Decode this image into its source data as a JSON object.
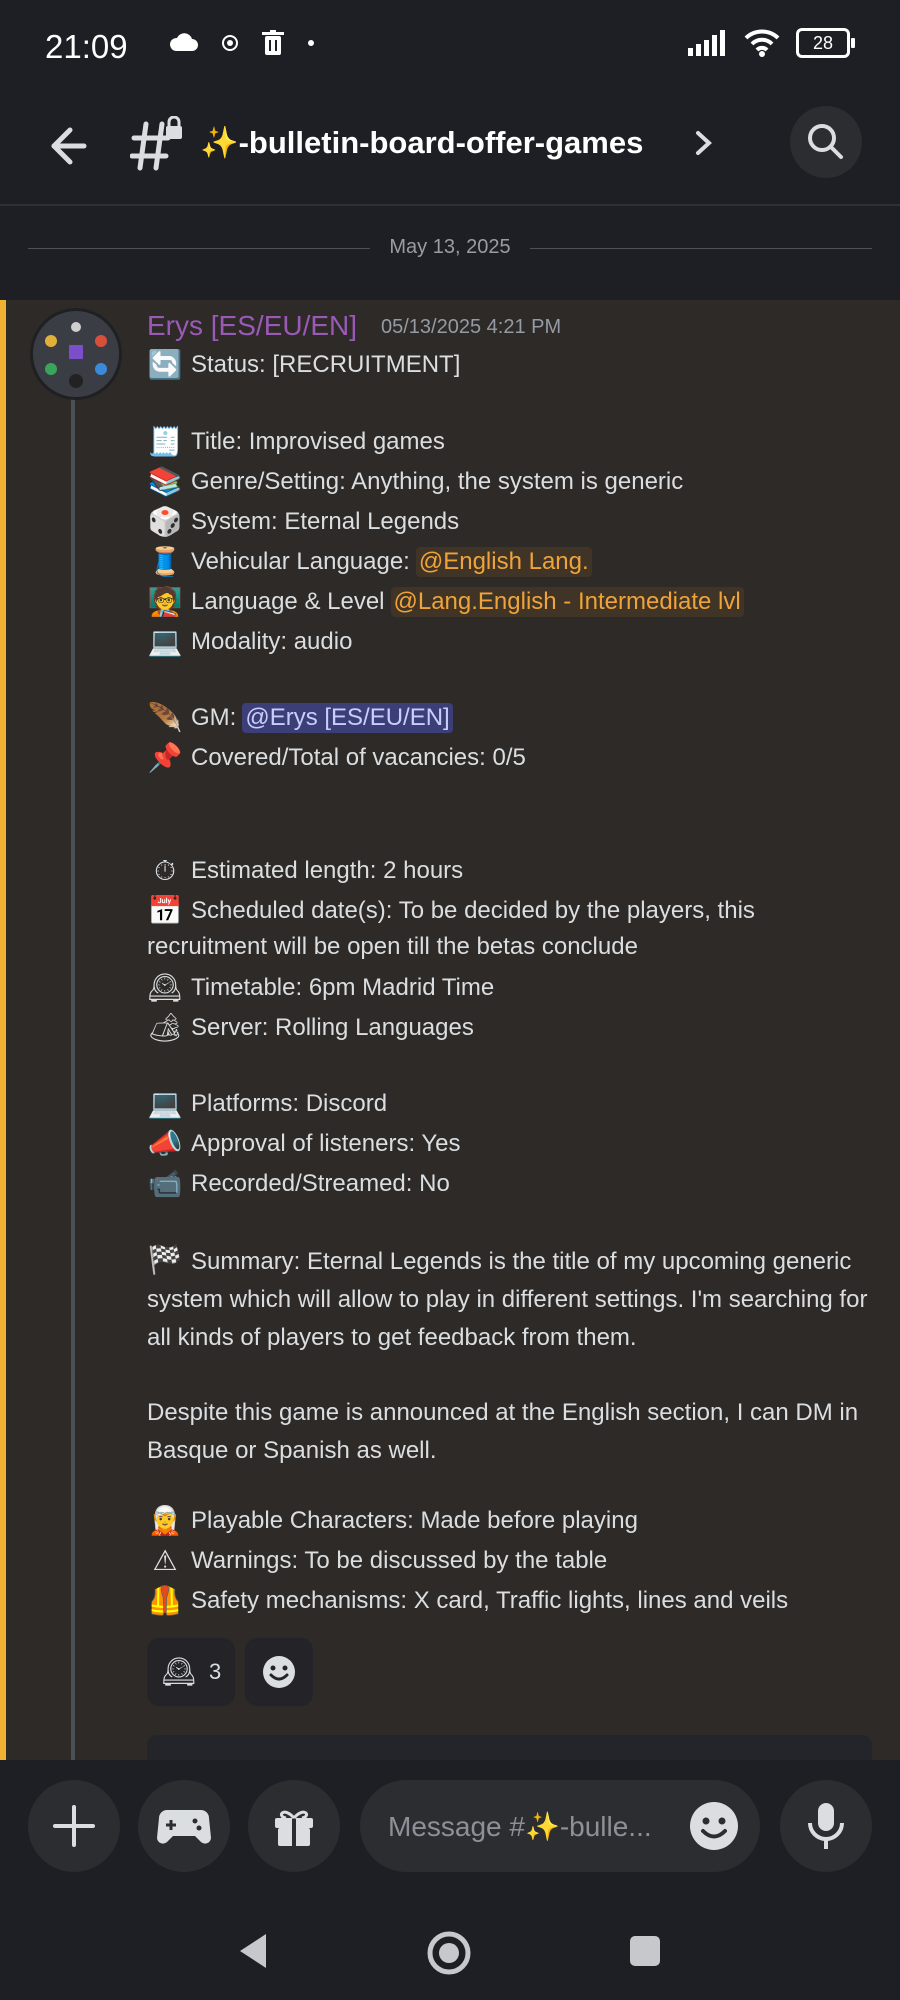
{
  "status_bar": {
    "time": "21:09",
    "battery": "28"
  },
  "header": {
    "channel_name": "✨-bulletin-board-offer-games"
  },
  "date_divider": "May 13, 2025",
  "message": {
    "author": "Erys [ES/EU/EN]",
    "timestamp": "05/13/2025 4:21 PM",
    "status": "Status: [RECRUITMENT]",
    "title": "Title: Improvised games",
    "genre": "Genre/Setting: Anything, the system is generic",
    "system": "System: Eternal Legends",
    "vehicular_label": "Vehicular Language:",
    "vehicular_mention": "@English Lang.",
    "level_label": "Language & Level",
    "level_mention": "@Lang.English - Intermediate lvl",
    "modality": "Modality: audio",
    "gm_label": "GM:",
    "gm_mention": "@Erys [ES/EU/EN]",
    "vacancies": "Covered/Total of vacancies: 0/5",
    "length": "Estimated length: 2 hours",
    "dates_1": "Scheduled date(s): To be decided by the players, this",
    "dates_2": "recruitment will be open till the betas conclude",
    "timetable": "Timetable: 6pm Madrid Time",
    "server": "Server: Rolling Languages",
    "platforms": "Platforms: Discord",
    "listeners": "Approval of listeners: Yes",
    "recorded": "Recorded/Streamed: No",
    "summary": "Summary: Eternal Legends is the title of my upcoming generic system which will allow to play in different settings. I'm searching for all kinds of players to get feedback from them.",
    "despite": "Despite this game is announced at the English section, I can DM in Basque or Spanish as well.",
    "characters": "Playable Characters: Made before playing",
    "warnings": "Warnings: To be discussed by the table",
    "safety": "Safety mechanisms: X card, Traffic lights, lines and veils",
    "reaction_count": "3"
  },
  "composer": {
    "placeholder": "Message #✨-bulle..."
  },
  "icons": {
    "status": "🔄",
    "title": "🧾",
    "genre": "📚",
    "system": "🎲",
    "vehicular": "🧵",
    "level": "🧑‍🏫",
    "modality": "💻",
    "gm": "🪶",
    "vacancies": "📌",
    "length": "⏱",
    "dates": "📅",
    "timetable": "🕰",
    "server": "🏕",
    "platforms": "💻",
    "listeners": "📣",
    "recorded": "📹",
    "summary": "🏁",
    "characters": "🧝",
    "warnings": "⚠",
    "safety": "🦺",
    "reaction": "🕰"
  },
  "colors": {
    "accent": "#f0b232",
    "author": "#9b59b6",
    "mention_role": "#f0a33a",
    "mention_user": "#c9cdfb"
  }
}
